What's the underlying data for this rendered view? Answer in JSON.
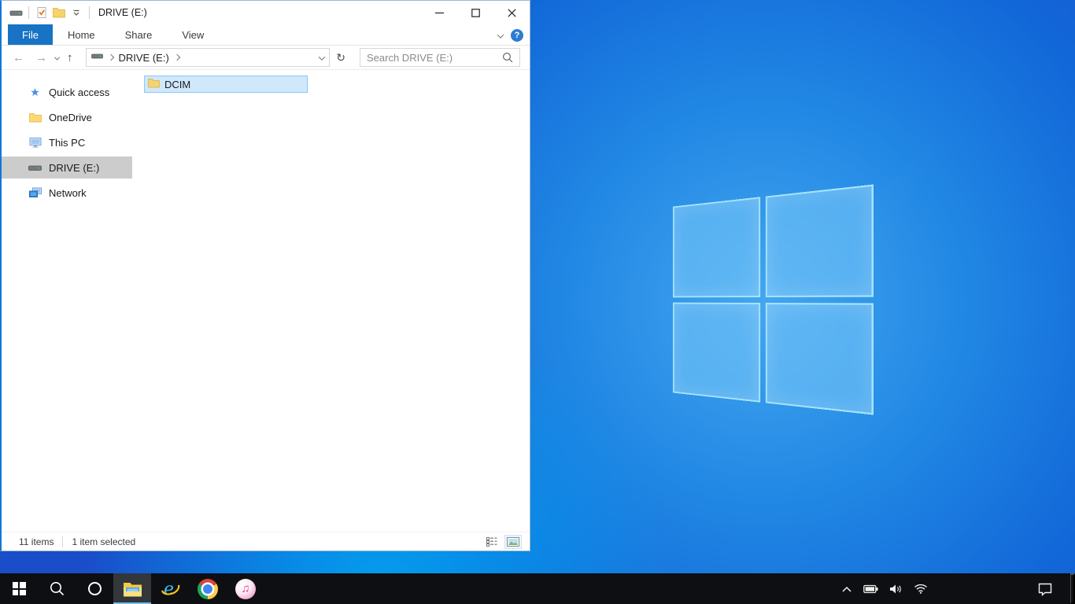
{
  "window": {
    "title": "DRIVE (E:)",
    "ribbon": {
      "tabs": [
        "File",
        "Home",
        "Share",
        "View"
      ],
      "help_label": "?"
    },
    "nav": {
      "breadcrumb_root": "DRIVE (E:)",
      "search_placeholder": "Search DRIVE (E:)"
    },
    "sidebar": [
      {
        "label": "Quick access"
      },
      {
        "label": "OneDrive"
      },
      {
        "label": "This PC"
      },
      {
        "label": "DRIVE (E:)",
        "selected": true
      },
      {
        "label": "Network"
      }
    ],
    "files": [
      {
        "name": "DCIM",
        "selected": true
      }
    ],
    "statusbar": {
      "count": "11 items",
      "selected": "1 item selected"
    }
  },
  "icons": {
    "quick_access_toolbar": [
      "drive-icon",
      "properties-icon",
      "new-folder-icon",
      "customize-quick-access-icon"
    ],
    "window_controls": [
      "minimize-icon",
      "maximize-icon",
      "close-icon"
    ],
    "navigation": [
      "back-icon",
      "forward-icon",
      "recent-locations-icon",
      "up-icon",
      "address-drive-icon",
      "refresh-icon",
      "search-icon"
    ],
    "sidebar": [
      "quick-access-icon",
      "onedrive-icon",
      "this-pc-icon",
      "drive-icon",
      "network-icon"
    ],
    "statusbar": [
      "details-view-icon",
      "thumbnails-view-icon"
    ],
    "taskbar": [
      "start-icon",
      "search-icon",
      "cortana-icon",
      "file-explorer-icon",
      "internet-explorer-icon",
      "chrome-icon",
      "itunes-icon"
    ],
    "tray": [
      "tray-expand-icon",
      "battery-icon",
      "volume-icon",
      "wifi-icon",
      "action-center-icon"
    ]
  },
  "colors": {
    "accent": "#0078d7",
    "file_tab": "#1873c5",
    "selection_fill": "#cfe8fc",
    "selection_border": "#8fc7f0",
    "sidebar_selected": "#cccccc",
    "taskbar_bg": "#0e0f12",
    "taskbar_underline": "#76b9ed",
    "desktop_center": "#45a5ef",
    "desktop_corner": "#1a4dc9",
    "folder_yellow": "#ffd970"
  }
}
